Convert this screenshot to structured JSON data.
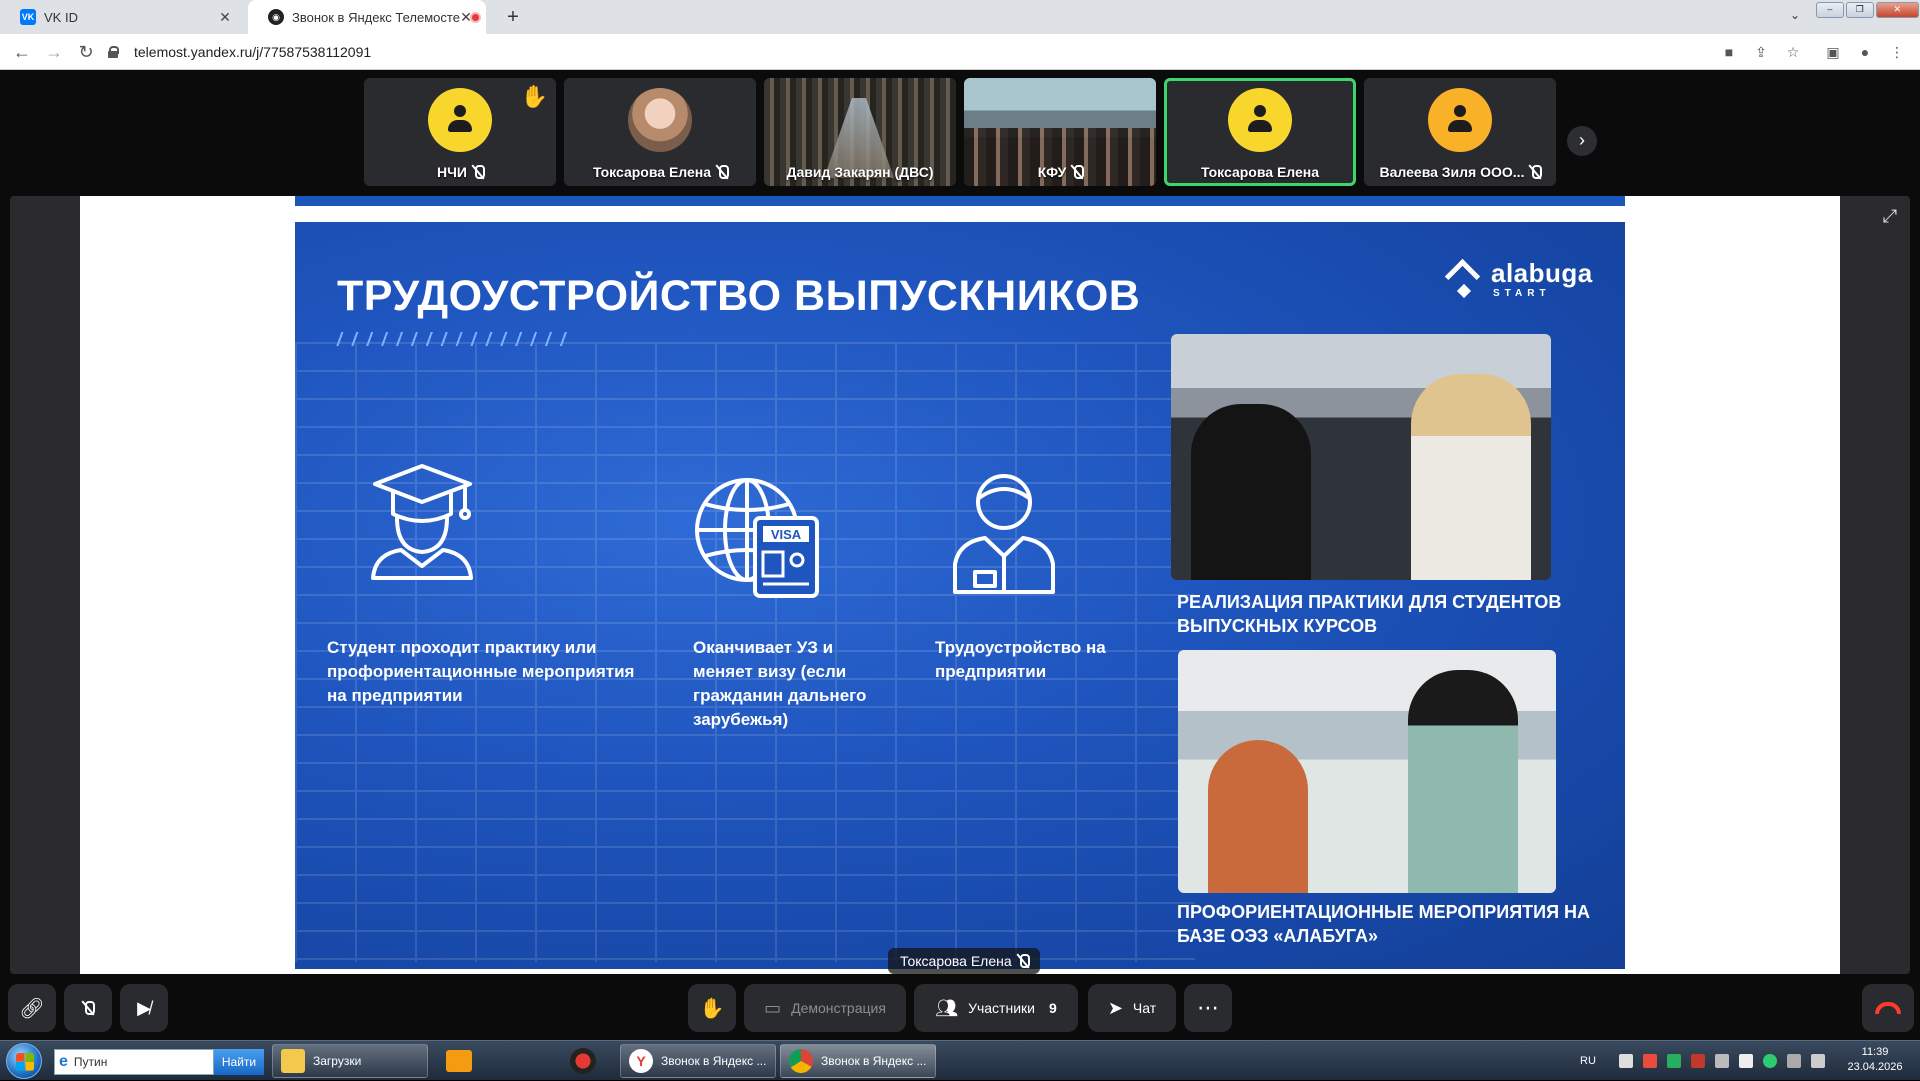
{
  "browser": {
    "tabs": [
      {
        "label": "VK ID",
        "favicon": "vk-icon",
        "active": false
      },
      {
        "label": "Звонок в Яндекс Телемосте",
        "favicon": "telemost-icon",
        "active": true
      }
    ],
    "new_tab": "+",
    "url": "telemost.yandex.ru/j/77587538112091"
  },
  "participants": [
    {
      "name": "НЧИ",
      "kind": "avatar",
      "color": "#f8d62c",
      "mic_off": true,
      "hand_raised": true
    },
    {
      "name": "Токсарова Елена",
      "kind": "photo",
      "mic_off": true
    },
    {
      "name": "Давид Закарян (ДВС)",
      "kind": "video",
      "mic_off": false
    },
    {
      "name": "КФУ",
      "kind": "video",
      "mic_off": true
    },
    {
      "name": "Токсарова Елена",
      "kind": "avatar",
      "color": "#f8d62c",
      "active": true,
      "mic_off": false
    },
    {
      "name": "Валеева Зиля ООО...",
      "kind": "avatar",
      "color": "#f9b128",
      "mic_off": true
    }
  ],
  "slide": {
    "title": "ТРУДОУСТРОЙСТВО ВЫПУСКНИКОВ",
    "brand_name": "alabuga",
    "brand_sub": "START",
    "steps": [
      {
        "text": "Студент проходит практику или профориентационные мероприятия на предприятии",
        "icon": "graduate-icon"
      },
      {
        "text": "Оканчивает УЗ и меняет визу (если гражданин дальнего зарубежья)",
        "icon": "globe-visa-icon",
        "visa_label": "VISA"
      },
      {
        "text": "Трудоустройство на предприятии",
        "icon": "worker-icon"
      }
    ],
    "photo_captions": [
      "РЕАЛИЗАЦИЯ ПРАКТИКИ ДЛЯ СТУДЕНТОВ ВЫПУСКНЫХ КУРСОВ",
      "ПРОФОРИЕНТАЦИОННЫЕ МЕРОПРИЯТИЯ НА БАЗЕ ОЭЗ «АЛАБУГА»"
    ]
  },
  "speaker_label": "Токсарова Елена",
  "controls": {
    "demo_label": "Демонстрация",
    "participants_label": "Участники",
    "participants_count": "9",
    "chat_label": "Чат",
    "more": "⋯"
  },
  "taskbar": {
    "search_value": "Путин",
    "search_button": "Найти",
    "items": [
      {
        "label": "Загрузки"
      },
      {
        "label": "Звонок в Яндекс ..."
      },
      {
        "label": "Звонок в Яндекс ..."
      }
    ],
    "lang": "RU",
    "time": "11:39",
    "date": "23.04.2026"
  }
}
